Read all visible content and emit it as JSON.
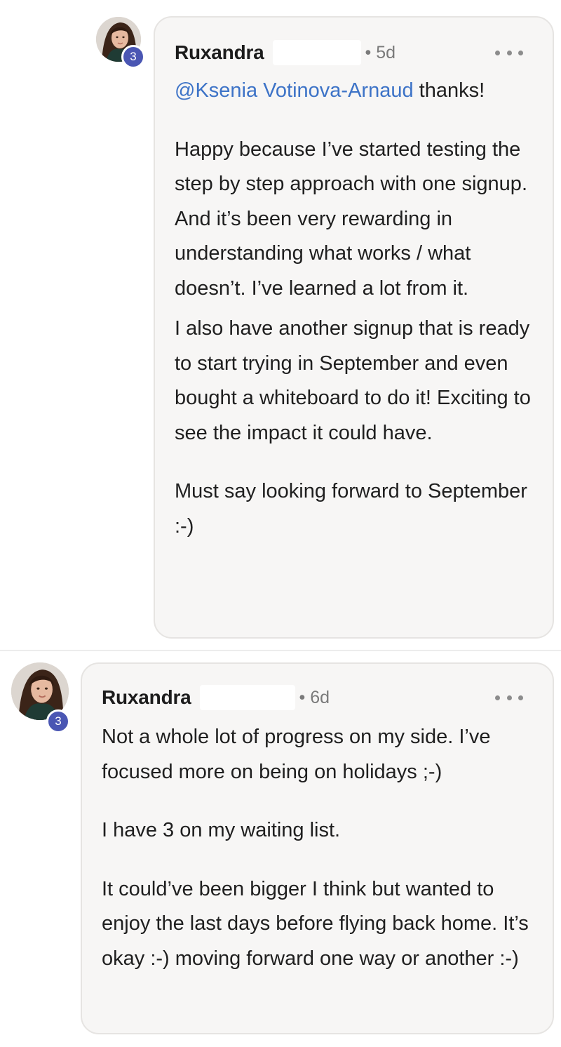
{
  "comments": [
    {
      "author": "Ruxandra",
      "time": "5d",
      "level": "3",
      "mention": "@Ksenia Votinova-Arnaud",
      "after_mention": " thanks!",
      "paragraphs": [
        "Happy because I’ve started testing the step by step approach with one signup. And it’s been very rewarding in understanding what works / what doesn’t. I’ve learned a lot from it.",
        "I also have another signup that is ready to start trying in September and even bought a whiteboard to do it! Exciting to see the impact it could have.",
        "Must say looking forward to September :-)"
      ]
    },
    {
      "author": "Ruxandra",
      "time": "6d",
      "level": "3",
      "paragraphs": [
        "Not a whole lot of progress on my side. I’ve focused more on being on holidays ;-)",
        "I have 3 on my waiting list.",
        "It could’ve been bigger I think but wanted to enjoy the last days before flying back home. It’s okay :-) moving forward one way or another :-)"
      ]
    }
  ],
  "icons": {
    "more": "more-horizontal-icon",
    "dot": "•"
  },
  "colors": {
    "mention": "#3d73c7",
    "badge": "#4a56b3",
    "bubble": "#f7f6f5"
  }
}
